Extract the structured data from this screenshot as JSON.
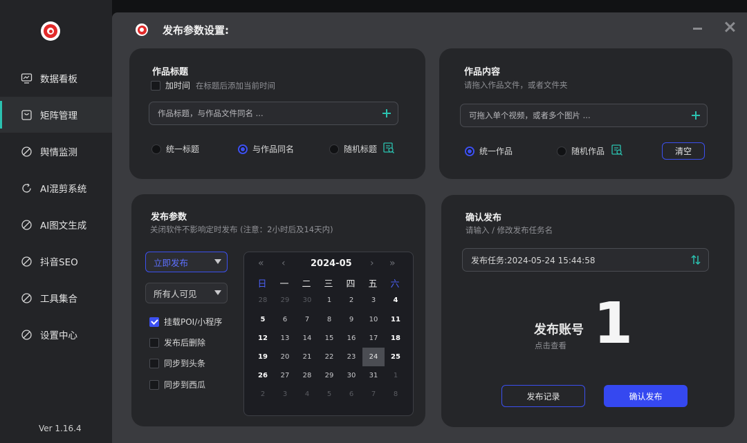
{
  "sidebar": {
    "items": [
      {
        "label": "数据看板",
        "icon": "monitor-chart-icon"
      },
      {
        "label": "矩阵管理",
        "icon": "bag-icon",
        "active": true
      },
      {
        "label": "舆情监测",
        "icon": "slash-circle-icon"
      },
      {
        "label": "AI混剪系统",
        "icon": "refresh-icon"
      },
      {
        "label": "AI图文生成",
        "icon": "slash-circle-icon"
      },
      {
        "label": "抖音SEO",
        "icon": "slash-circle-icon"
      },
      {
        "label": "工具集合",
        "icon": "slash-circle-icon"
      },
      {
        "label": "设置中心",
        "icon": "slash-circle-icon"
      }
    ],
    "version": "Ver 1.16.4"
  },
  "window": {
    "title": "发布参数设置:"
  },
  "title_card": {
    "title": "作品标题",
    "add_time_label": "加时间",
    "add_time_hint": "在标题后添加当前时间",
    "input_placeholder": "作品标题，与作品文件同名 ...",
    "options": [
      "统一标题",
      "与作品同名",
      "随机标题"
    ],
    "selected": "与作品同名"
  },
  "content_card": {
    "title": "作品内容",
    "subtitle": "请拖入作品文件，或者文件夹",
    "input_placeholder": "可拖入单个视频，或者多个图片 ...",
    "options": [
      "统一作品",
      "随机作品"
    ],
    "selected": "统一作品",
    "clear_label": "清空"
  },
  "params_card": {
    "title": "发布参数",
    "subtitle": "关闭软件不影响定时发布  (注意：2小时后及14天内)",
    "publish_mode": "立即发布",
    "visibility": "所有人可见",
    "checks": [
      {
        "label": "挂载POI/小程序",
        "checked": true
      },
      {
        "label": "发布后删除",
        "checked": false
      },
      {
        "label": "同步到头条",
        "checked": false
      },
      {
        "label": "同步到西瓜",
        "checked": false
      }
    ]
  },
  "calendar": {
    "month_label": "2024-05",
    "nav": [
      "«",
      "‹",
      "›",
      "»"
    ],
    "weekdays": [
      "日",
      "一",
      "二",
      "三",
      "四",
      "五",
      "六"
    ],
    "selected_day": "24",
    "weeks": [
      [
        "28",
        "29",
        "30",
        "1",
        "2",
        "3",
        "4"
      ],
      [
        "5",
        "6",
        "7",
        "8",
        "9",
        "10",
        "11"
      ],
      [
        "12",
        "13",
        "14",
        "15",
        "16",
        "17",
        "18"
      ],
      [
        "19",
        "20",
        "21",
        "22",
        "23",
        "24",
        "25"
      ],
      [
        "26",
        "27",
        "28",
        "29",
        "30",
        "31",
        "1"
      ],
      [
        "2",
        "3",
        "4",
        "5",
        "6",
        "7",
        "8"
      ]
    ]
  },
  "confirm_card": {
    "title": "确认发布",
    "subtitle": "请输入 / 修改发布任务名",
    "task_value": "发布任务:2024-05-24 15:44:58",
    "account_label": "发布账号",
    "account_sub": "点击查看",
    "account_count": "1",
    "history_label": "发布记录",
    "confirm_label": "确认发布"
  },
  "colors": {
    "accent_blue": "#3c50f0",
    "accent_teal": "#2bc2b0",
    "card_bg": "#252629",
    "window_bg": "#3a3b3f"
  }
}
